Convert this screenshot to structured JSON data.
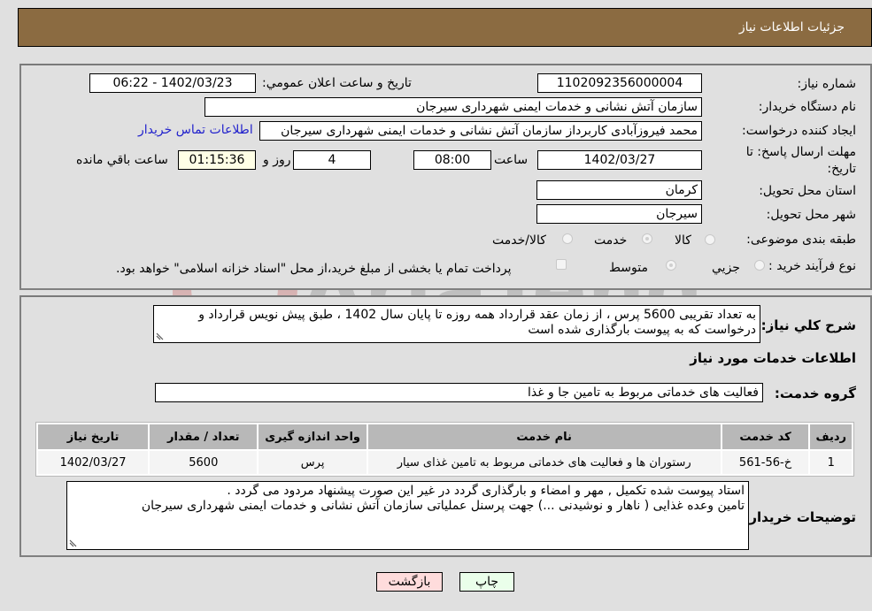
{
  "header": {
    "title": "جزئیات اطلاعات نیاز"
  },
  "form": {
    "need_number_label": "شماره نیاز:",
    "need_number": "1102092356000004",
    "announce_label": "تاریخ و ساعت اعلان عمومي:",
    "announce_value": "1402/03/23 - 06:22",
    "buyer_org_label": "نام دستگاه خریدار:",
    "buyer_org": "سازمان آتش نشانی و خدمات ایمنی شهرداری سیرجان",
    "creator_label": "ایجاد کننده درخواست:",
    "creator": "محمد فیروزآبادی کاربرداز سازمان آتش نشانی و خدمات ایمنی شهرداری سیرجان",
    "buyer_contact_link": "اطلاعات تماس خریدار",
    "deadline_label": "مهلت ارسال پاسخ: تا تاریخ:",
    "deadline_date": "1402/03/27",
    "time_label": "ساعت",
    "deadline_time": "08:00",
    "days_value": "4",
    "days_label": "روز و",
    "remaining_time": "01:15:36",
    "remaining_label": "ساعت باقي مانده",
    "province_label": "استان محل تحویل:",
    "province": "کرمان",
    "city_label": "شهر محل تحویل:",
    "city": "سیرجان",
    "category_label": "طبقه بندی موضوعی:",
    "category_options": [
      {
        "label": "کالا",
        "checked": false
      },
      {
        "label": "خدمت",
        "checked": true
      },
      {
        "label": "کالا/خدمت",
        "checked": false
      }
    ],
    "process_label": "نوع فرآیند خرید :",
    "process_options": [
      {
        "label": "جزیي",
        "checked": false
      },
      {
        "label": "متوسط",
        "checked": true
      }
    ],
    "treasury_checkbox_label": "پرداخت تمام یا بخشی از مبلغ خرید،از محل \"اسناد خزانه اسلامی\" خواهد بود.",
    "treasury_checked": false
  },
  "details": {
    "description_label": "شرح کلي نیاز:",
    "description": "به تعداد تقریبی 5600 پرس ، از زمان عقد قرارداد همه روزه تا پایان سال 1402 ، طبق پیش نویس قرارداد و درخواست که به پیوست بارگذاری شده است",
    "services_heading": "اطلاعات خدمات مورد نیاز",
    "service_group_label": "گروه خدمت:",
    "service_group": "فعالیت های خدماتی مربوط به تامین جا و غذا",
    "table": {
      "headers": [
        "ردیف",
        "کد خدمت",
        "نام خدمت",
        "واحد اندازه گیری",
        "تعداد / مقدار",
        "تاریخ نیاز"
      ],
      "rows": [
        [
          "1",
          "خ-56-561",
          "رستوران ها و فعالیت های خدماتی مربوط به تامین غذای سیار",
          "پرس",
          "5600",
          "1402/03/27"
        ]
      ]
    },
    "buyer_notes_label": "توضیحات خریدار:",
    "buyer_notes_line1": "استاد پیوست شده تکمیل , مهر و امضاء و بارگذاری گردد در غیر این صورت پیشنهاد مردود می گردد .",
    "buyer_notes_line2": "تامین وعده غذایی ( ناهار و نوشیدنی ...) جهت پرسنل عملیاتی سازمان آتش نشانی و خدمات ایمنی شهرداری سیرجان"
  },
  "buttons": {
    "print": "چاپ",
    "back": "بازگشت"
  },
  "watermark": {
    "text": "AriaTender.neT"
  },
  "colors": {
    "header_bg": "#8b6b41",
    "print_bg": "#eaffea",
    "back_bg": "#ffdcdc",
    "link": "#2222cc"
  }
}
